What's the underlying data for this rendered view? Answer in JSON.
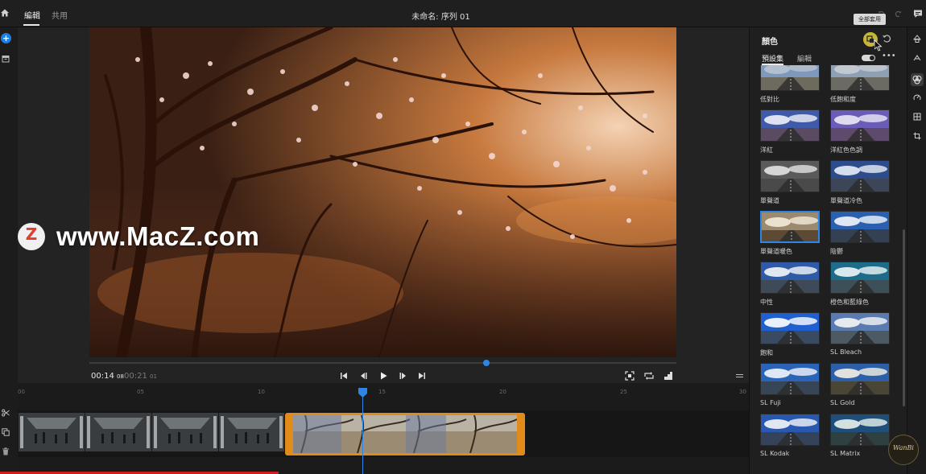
{
  "top_bar": {
    "tab_edit": "編輯",
    "tab_share": "共用",
    "title": "未命名: 序列 01",
    "tooltip": "全部套用"
  },
  "viewer": {
    "time_current": "00:14",
    "time_current_frames": "08",
    "time_total": "00:21",
    "time_total_frames": "01",
    "progress_fraction": 0.68
  },
  "watermark": {
    "badge_letter": "Z",
    "text": "www.MacZ.com"
  },
  "timeline": {
    "ruler_ticks": [
      "00",
      "05",
      "10",
      "15",
      "20",
      "25",
      "30"
    ],
    "playhead_label": ""
  },
  "panel": {
    "title": "顏色",
    "tab_presets": "預設集",
    "tab_edit": "編輯",
    "presets": [
      {
        "label": "低對比",
        "look": "lowcontrast"
      },
      {
        "label": "低飽和度",
        "look": "lowsat"
      },
      {
        "label": "洋紅",
        "look": "magenta"
      },
      {
        "label": "洋紅色色調",
        "look": "magentatone"
      },
      {
        "label": "單聲道",
        "look": "mono"
      },
      {
        "label": "單聲道冷色",
        "look": "monocool"
      },
      {
        "label": "單聲道暖色",
        "look": "monowarm",
        "selected": true
      },
      {
        "label": "陰鬱",
        "look": "gloomy"
      },
      {
        "label": "中性",
        "look": "neutral"
      },
      {
        "label": "橙色和藍綠色",
        "look": "orangeteal"
      },
      {
        "label": "飽和",
        "look": "saturated"
      },
      {
        "label": "SL Bleach",
        "look": "bleach"
      },
      {
        "label": "SL Fuji",
        "look": "fuji"
      },
      {
        "label": "SL Gold",
        "look": "gold"
      },
      {
        "label": "SL Kodak",
        "look": "kodak"
      },
      {
        "label": "SL Matrix",
        "look": "matrix"
      }
    ]
  },
  "logo": {
    "text": "WanBi"
  },
  "colors": {
    "accent_blue": "#2d86e6",
    "clip_selected": "#e08b1a",
    "apply_button": "#c8b638"
  }
}
